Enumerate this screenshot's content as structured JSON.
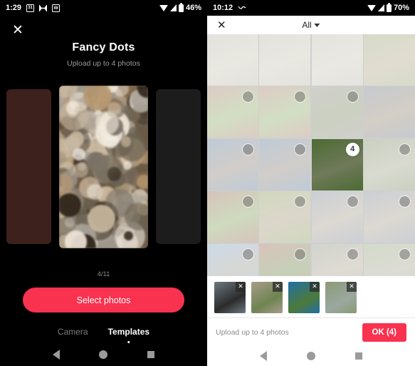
{
  "left_phone": {
    "status_bar": {
      "time": "1:29",
      "battery": "46%",
      "icons": [
        "calendar-icon",
        "messages-icon",
        "wordpress-icon",
        "wifi-icon",
        "signal-icon",
        "battery-icon"
      ],
      "calendar_day": "31",
      "app_letter": "W"
    },
    "close_label": "✕",
    "title": "Fancy Dots",
    "subtitle": "Upload up to 4 photos",
    "counter": "4/11",
    "select_button": "Select photos",
    "tabs": [
      {
        "label": "Camera",
        "active": false
      },
      {
        "label": "Templates",
        "active": true
      }
    ],
    "nav": [
      "back-button",
      "home-button",
      "recents-button"
    ]
  },
  "right_phone": {
    "status_bar": {
      "time": "10:12",
      "battery": "70%",
      "icons": [
        "wave-icon",
        "wifi-icon",
        "signal-icon",
        "battery-icon"
      ]
    },
    "header": {
      "close_label": "✕",
      "album_label": "All"
    },
    "grid": {
      "columns": 4,
      "cells": [
        {
          "subject": "white-bird-on-pavement",
          "c1": "#b9b6a9",
          "c2": "#c8c5b4",
          "selected": false,
          "selectable": false
        },
        {
          "subject": "white-bird-on-pavement",
          "c1": "#b9b6a9",
          "c2": "#c8c5b4",
          "selected": false,
          "selectable": false
        },
        {
          "subject": "white-bird-on-pavement",
          "c1": "#bcb9ac",
          "c2": "#c9c6b6",
          "selected": false,
          "selectable": false
        },
        {
          "subject": "cat-on-grass",
          "c1": "#9aa478",
          "c2": "#b4a98c",
          "selected": false,
          "selectable": false
        },
        {
          "subject": "potted-plants-brick-wall",
          "c1": "#a9806c",
          "c2": "#8fae6c",
          "selected": false,
          "selectable": true
        },
        {
          "subject": "potted-plants-brick-wall",
          "c1": "#a9806c",
          "c2": "#8fae6c",
          "selected": false,
          "selectable": true
        },
        {
          "subject": "plant-by-doorway",
          "c1": "#8a8a82",
          "c2": "#7e8b62",
          "selected": false,
          "selectable": true
        },
        {
          "subject": "trash-bins-with-cat",
          "c1": "#6f7a86",
          "c2": "#93846f",
          "selected": false,
          "selectable": false
        },
        {
          "subject": "trash-bins-with-cat",
          "c1": "#5e7c9c",
          "c2": "#8c8378",
          "selected": false,
          "selectable": true
        },
        {
          "subject": "trash-bins-with-cat",
          "c1": "#5e7c9c",
          "c2": "#8c8378",
          "selected": false,
          "selectable": true
        },
        {
          "subject": "canada-geese-on-grass",
          "c1": "#4d6b33",
          "c2": "#6f7a5a",
          "selected": true,
          "badge": "4",
          "selectable": true
        },
        {
          "subject": "canada-geese-on-grass",
          "c1": "#7d8a63",
          "c2": "#a0a48c",
          "selected": false,
          "selectable": true
        },
        {
          "subject": "planter-with-flowers",
          "c1": "#9a6a55",
          "c2": "#86a45f",
          "selected": false,
          "selectable": true
        },
        {
          "subject": "garden-planters-lawn",
          "c1": "#8aa05c",
          "c2": "#a89a7e",
          "selected": false,
          "selectable": true
        },
        {
          "subject": "bins-on-sidewalk",
          "c1": "#7d8794",
          "c2": "#a89f90",
          "selected": false,
          "selectable": true
        },
        {
          "subject": "bins-on-sidewalk",
          "c1": "#7d8794",
          "c2": "#a89f90",
          "selected": false,
          "selectable": true
        },
        {
          "subject": "car-on-street",
          "c1": "#7fa3c4",
          "c2": "#9c9c94",
          "selected": false,
          "selectable": true
        },
        {
          "subject": "person-by-brick-house",
          "c1": "#9c6a52",
          "c2": "#6f8a52",
          "selected": false,
          "selectable": true
        },
        {
          "subject": "bird-near-iron-fence",
          "c1": "#8d9382",
          "c2": "#ada692",
          "selected": false,
          "selectable": true
        },
        {
          "subject": "trees-and-sidewalk",
          "c1": "#8fa57a",
          "c2": "#a8a694",
          "selected": false,
          "selectable": true
        },
        {
          "subject": "street-with-hedges",
          "c1": "#7ea2c0",
          "c2": "#93a082",
          "selected": false,
          "selectable": true
        },
        {
          "subject": "street-with-hedges",
          "c1": "#7ea2c0",
          "c2": "#93a082",
          "selected": false,
          "selectable": true
        },
        {
          "subject": "bookshelf-spines",
          "c1": "#a5624e",
          "c2": "#7c6a58",
          "selected": false,
          "selectable": true
        },
        {
          "subject": "bookshelf-spines",
          "c1": "#a5624e",
          "c2": "#7c6a58",
          "selected": false,
          "selectable": true
        }
      ]
    },
    "selected_strip": [
      {
        "subject": "black-bird-on-railing",
        "remove_label": "✕",
        "c1": "#6d7a82",
        "c2": "#2b2b2b"
      },
      {
        "subject": "bird-on-dirt-path",
        "remove_label": "✕",
        "c1": "#a89c8c",
        "c2": "#6f8450"
      },
      {
        "subject": "peacock-on-railing",
        "remove_label": "✕",
        "c1": "#1f6fa8",
        "c2": "#4d7a3a"
      },
      {
        "subject": "geese-on-path",
        "remove_label": "✕",
        "c1": "#8a9a74",
        "c2": "#9aa8a0"
      }
    ],
    "footer": {
      "hint": "Upload up to 4 photos",
      "ok_label": "OK (4)"
    },
    "nav": [
      "back-button",
      "home-button",
      "recents-button"
    ]
  },
  "colors": {
    "accent_pink": "#f9324f",
    "dark_bg": "#000000",
    "card_left": "#3d211c",
    "card_right": "#1c1c1c"
  },
  "bokeh_palette": [
    "#d9c5a8",
    "#b89a72",
    "#efe6d8",
    "#8a6f4e",
    "#2e2419",
    "#c9b8a0",
    "#a8a198",
    "#6b6253",
    "#f2ece1",
    "#7d7468"
  ]
}
